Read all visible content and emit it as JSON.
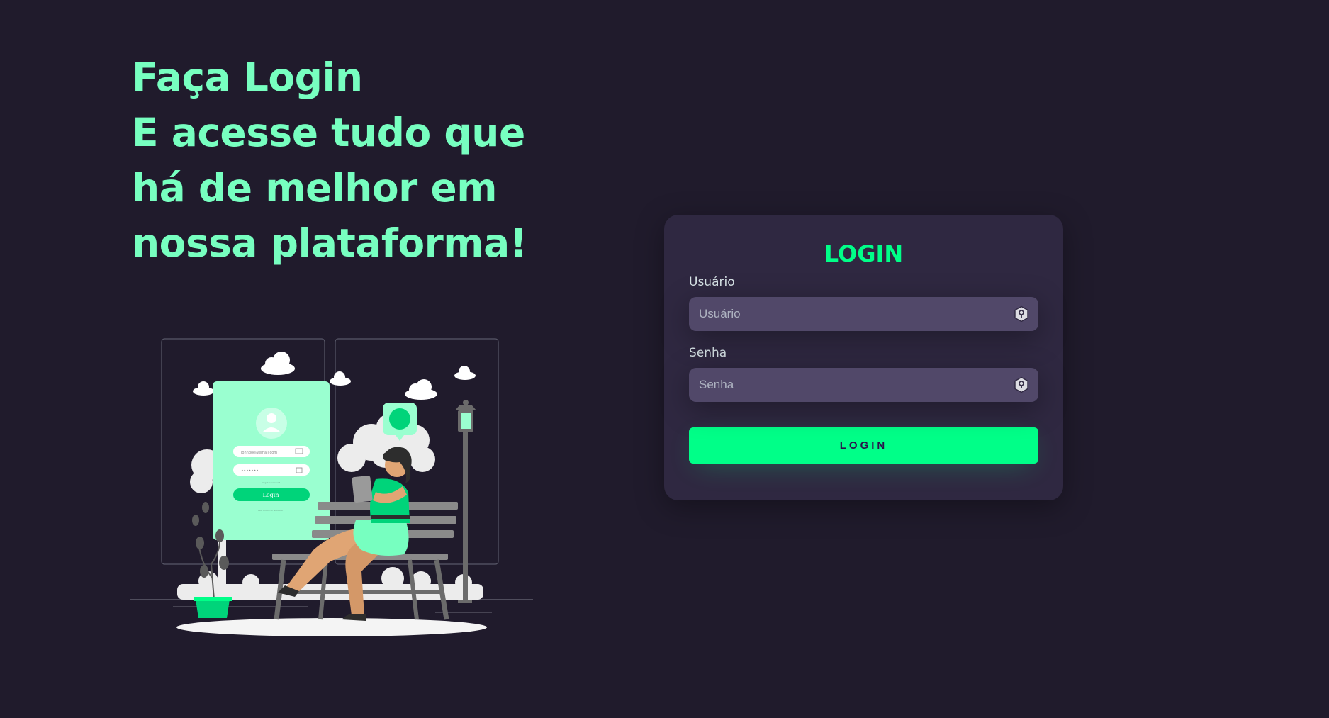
{
  "hero": {
    "headline_lines": [
      "Faça Login",
      "E acesse tudo que",
      "há de melhor em",
      "nossa plataforma!"
    ]
  },
  "illustration": {
    "mock_email": "johndoe@email.com",
    "mock_password": "•••••••",
    "mock_button": "Login",
    "mock_forgot": "Forgot password?",
    "mock_signup": "Don't have an account?"
  },
  "login_card": {
    "title": "LOGIN",
    "username_label": "Usuário",
    "username_placeholder": "Usuário",
    "password_label": "Senha",
    "password_placeholder": "Senha",
    "submit_label": "LOGIN"
  },
  "colors": {
    "background": "#201b2c",
    "card": "#2f2841",
    "input": "#514869",
    "accent": "#00ff88",
    "headline": "#77ffc0"
  },
  "icons": {
    "field_icon": "keyhole-badge-icon"
  }
}
